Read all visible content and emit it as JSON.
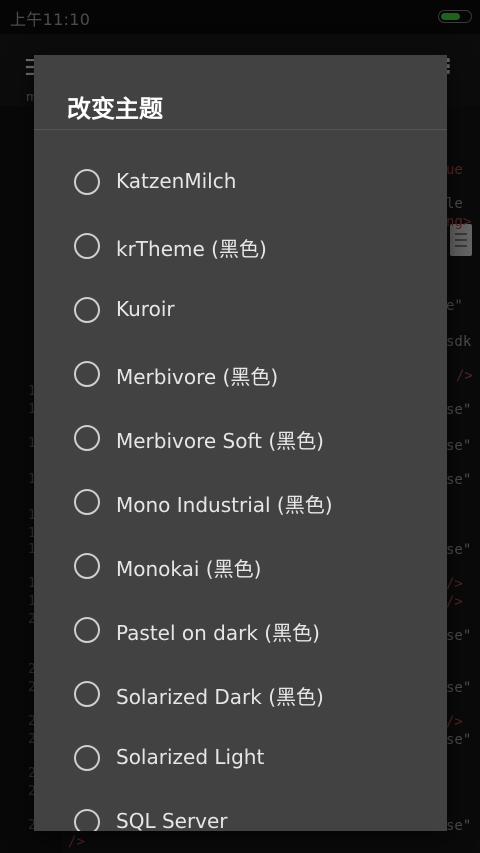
{
  "status_bar": {
    "time": "上午11:10",
    "battery_color": "#37b536"
  },
  "background_app": {
    "menu_icon": "menu-icon",
    "subtitle": "m",
    "overflow_icon": "more-vert-icon",
    "line_numbers": [
      "1",
      "1",
      "1",
      "1",
      "1",
      "1",
      "1",
      "1",
      "1",
      "2",
      "2",
      "2",
      "2",
      "2",
      "2",
      "2",
      "2"
    ],
    "code_fragments": [
      "ue",
      "le",
      "ng>",
      "e\"",
      "sdk",
      "/>",
      "se\"",
      "se\"",
      "se\"",
      "se\"",
      "/>",
      "/>",
      "se\"",
      "se\"",
      "/>",
      "se\"",
      "se\"",
      "/>"
    ]
  },
  "dialog": {
    "title": "改变主题",
    "options": [
      {
        "label": "KatzenMilch",
        "selected": false
      },
      {
        "label": "krTheme (黑色)",
        "selected": false
      },
      {
        "label": "Kuroir",
        "selected": false
      },
      {
        "label": "Merbivore (黑色)",
        "selected": false
      },
      {
        "label": "Merbivore Soft (黑色)",
        "selected": false
      },
      {
        "label": "Mono Industrial (黑色)",
        "selected": false
      },
      {
        "label": "Monokai (黑色)",
        "selected": false
      },
      {
        "label": "Pastel on dark (黑色)",
        "selected": false
      },
      {
        "label": "Solarized Dark (黑色)",
        "selected": false
      },
      {
        "label": "Solarized Light",
        "selected": false
      },
      {
        "label": "SQL Server",
        "selected": false
      }
    ]
  }
}
